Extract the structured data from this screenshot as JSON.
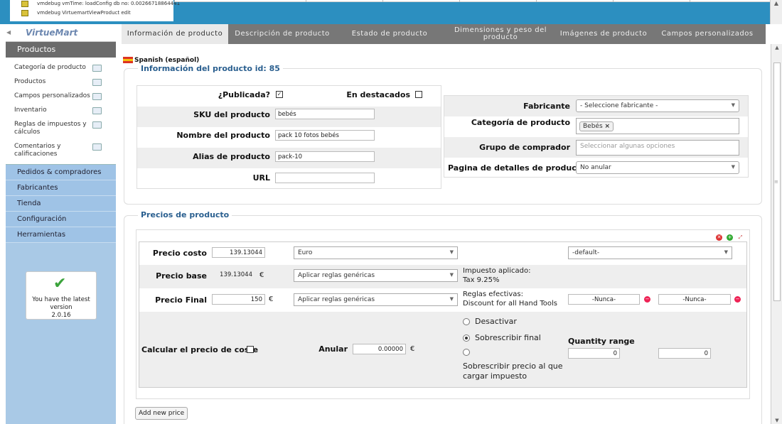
{
  "debug": {
    "line1": "vmdebug vmTime: loadConfig db no: 0.00266718864441",
    "line2": "vmdebug VirtuemartViewProduct edit"
  },
  "sidebar": {
    "logo": "VirtueMart",
    "header": "Productos",
    "items": [
      {
        "label": "Categoría de producto",
        "icon": "folder-icon"
      },
      {
        "label": "Productos",
        "icon": "products-icon"
      },
      {
        "label": "Campos personalizados",
        "icon": "custom-fields-icon"
      },
      {
        "label": "Inventario",
        "icon": "inventory-icon"
      },
      {
        "label": "Reglas de impuestos y cálculos",
        "icon": "calculator-icon"
      },
      {
        "label": "Comentarios y calificaciones",
        "icon": "comments-icon"
      }
    ],
    "sections": [
      "Pedidos & compradores",
      "Fabricantes",
      "Tienda",
      "Configuración",
      "Herramientas"
    ],
    "version_box": {
      "line1": "You have the latest",
      "line2": "version",
      "line3": "2.0.16"
    }
  },
  "tabs": [
    {
      "label": "Información de producto",
      "active": true
    },
    {
      "label": "Descripción de producto",
      "active": false
    },
    {
      "label": "Estado de producto",
      "active": false
    },
    {
      "label": "Dimensiones y peso del producto",
      "active": false
    },
    {
      "label": "Imágenes de producto",
      "active": false
    },
    {
      "label": "Campos personalizados",
      "active": false
    }
  ],
  "language": "Spanish (español)",
  "info": {
    "legend": "Información del producto id: 85",
    "published_label": "¿Publicada?",
    "published": true,
    "featured_label": "En destacados",
    "featured": false,
    "sku_label": "SKU del producto",
    "sku_value": "bebés",
    "name_label": "Nombre del producto",
    "name_value": "pack 10 fotos bebés",
    "alias_label": "Alias de producto",
    "alias_value": "pack-10",
    "url_label": "URL",
    "url_value": "",
    "manufacturer_label": "Fabricante",
    "manufacturer_value": "- Seleccione fabricante -",
    "category_label": "Categoría de producto",
    "category_tag": "Bebés",
    "shopper_group_label": "Grupo de comprador",
    "shopper_group_placeholder": "Seleccionar algunas opciones",
    "detail_page_label": "Pagina de detalles de producto",
    "detail_page_value": "No anular"
  },
  "prices": {
    "legend": "Precios de producto",
    "cost_label": "Precio costo",
    "cost_value": "139.13044",
    "currency": "Euro",
    "shopper_default": "-default-",
    "base_label": "Precio base",
    "base_value": "139.13044",
    "euro_symbol": "€",
    "base_rule": "Aplicar reglas genéricas",
    "tax_applied_label": "Impuesto aplicado:",
    "tax_applied_value": "Tax 9.25%",
    "final_label": "Precio Final",
    "final_value": "150",
    "final_rule": "Aplicar reglas genéricas",
    "effective_rules_label": "Reglas efectivas:",
    "effective_rules_value": "Discount for all Hand Tools",
    "never_1": "-Nunca-",
    "never_2": "-Nunca-",
    "calc_cost_label": "Calcular el precio de coste",
    "override_label": "Anular",
    "override_value": "0.00000",
    "radio_disable": "Desactivar",
    "radio_overwrite_final": "Sobrescribir final",
    "radio_overwrite_tax_line1": "Sobrescribir precio al que",
    "radio_overwrite_tax_line2": "cargar impuesto",
    "quantity_range_label": "Quantity range",
    "qty_from": "0",
    "qty_to": "0",
    "add_price_button": "Add new price"
  }
}
